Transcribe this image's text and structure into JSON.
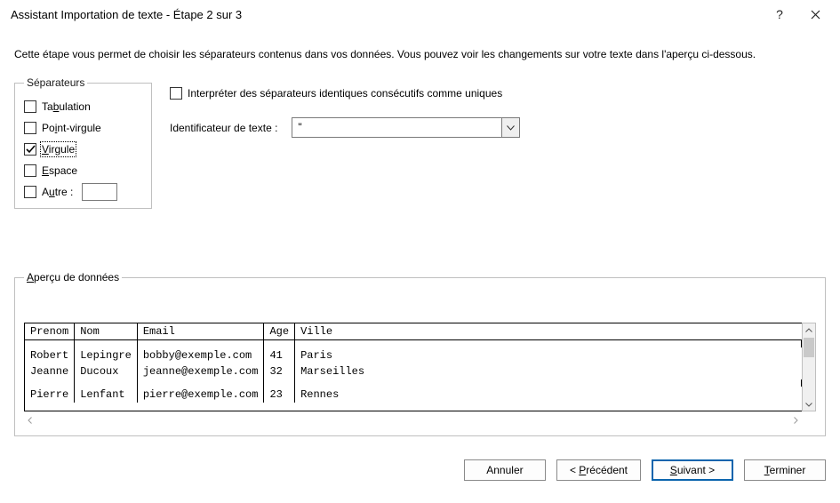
{
  "window": {
    "title": "Assistant Importation de texte - Étape 2 sur 3",
    "help": "?",
    "close": "✕"
  },
  "intro": "Cette étape vous permet de choisir les séparateurs contenus dans vos données. Vous pouvez voir les changements sur votre texte dans l'aperçu ci-dessous.",
  "separators": {
    "legend": "Séparateurs",
    "tab": "Tabulation",
    "semicolon": "Point-virgule",
    "comma": "Virgule",
    "space": "Espace",
    "other": "Autre :"
  },
  "options": {
    "treat_consecutive": "Interpréter des séparateurs identiques consécutifs comme uniques",
    "text_qualifier_label": "Identificateur de texte :",
    "text_qualifier_value": "\""
  },
  "preview": {
    "legend": "Aperçu de données",
    "headers": [
      "Prenom",
      "Nom",
      "Email",
      "Age",
      "Ville"
    ],
    "rows": [
      [
        "Robert",
        "Lepingre",
        "bobby@exemple.com",
        "41",
        "Paris"
      ],
      [
        "Jeanne",
        "Ducoux",
        "jeanne@exemple.com",
        "32",
        "Marseilles"
      ],
      [
        "Pierre",
        "Lenfant",
        "pierre@exemple.com",
        "23",
        "Rennes"
      ]
    ]
  },
  "buttons": {
    "cancel": "Annuler",
    "back": "< Précédent",
    "next": "Suivant >",
    "finish": "Terminer"
  }
}
